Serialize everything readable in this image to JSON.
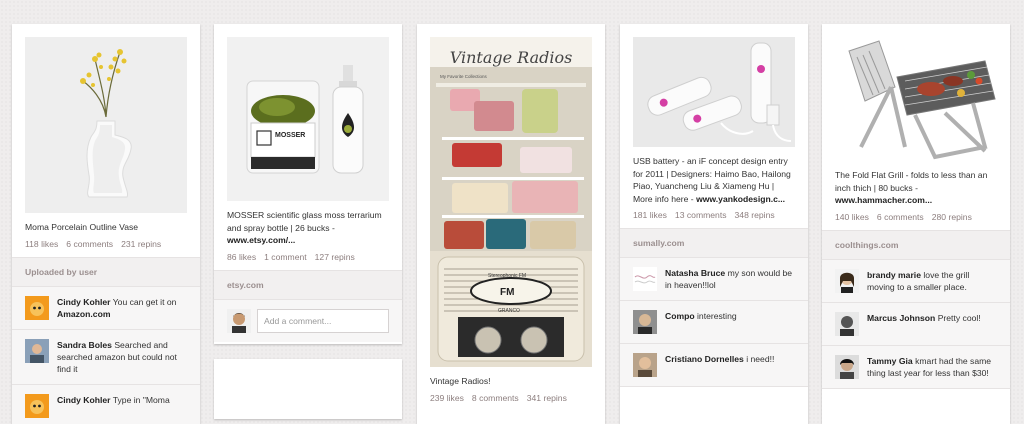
{
  "pins": [
    {
      "description": "Moma Porcelain Outline Vase",
      "likes": "118 likes",
      "comments": "6 comments",
      "repins": "231 repins",
      "via": "Uploaded by user",
      "comment_list": [
        {
          "user": "Cindy Kohler",
          "text": "You can get it on ",
          "bold": "Amazon.com"
        },
        {
          "user": "Sandra Boles",
          "text": "Searched and searched amazon but could not find it",
          "bold": ""
        },
        {
          "user": "Cindy Kohler",
          "text": "Type in \"Moma",
          "bold": ""
        }
      ]
    },
    {
      "description": "MOSSER scientific glass moss terrarium and spray bottle | 26 bucks - ",
      "source": "www.etsy.com/...",
      "likes": "86 likes",
      "comments": "1 comment",
      "repins": "127 repins",
      "via": "etsy.com",
      "add_comment_placeholder": "Add a comment...",
      "terrarium_label": "MOSSER"
    },
    {
      "image_title": "Vintage Radios",
      "collection_label": "My Favorite Collections",
      "radio_brand": "FM",
      "radio_maker": "GRANCO",
      "radio_band": "Stereophonic FM",
      "description": "Vintage Radios!",
      "likes": "239 likes",
      "comments": "8 comments",
      "repins": "341 repins"
    },
    {
      "description": "USB battery - an iF concept design entry for 2011 | Designers: Haimo Bao, Hailong Piao, Yuancheng Liu & Xiameng Hu | More info here - ",
      "source": "www.yankodesign.c...",
      "likes": "181 likes",
      "comments": "13 comments",
      "repins": "348 repins",
      "via": "sumally.com",
      "comment_list": [
        {
          "user": "Natasha Bruce",
          "text": "my son would be in heaven!!lol",
          "bold": ""
        },
        {
          "user": "Compo",
          "text": "interesting",
          "bold": ""
        },
        {
          "user": "Cristiano Dornelles",
          "text": "i need!!",
          "bold": ""
        }
      ]
    },
    {
      "description": "The Fold Flat Grill - folds to less than an inch thich | 80 bucks - ",
      "source": "www.hammacher.com...",
      "likes": "140 likes",
      "comments": "6 comments",
      "repins": "280 repins",
      "via": "coolthings.com",
      "comment_list": [
        {
          "user": "brandy marie",
          "text": "love the grill moving to a smaller place.",
          "bold": ""
        },
        {
          "user": "Marcus Johnson",
          "text": "Pretty cool!",
          "bold": ""
        },
        {
          "user": "Tammy Gia",
          "text": "kmart had the same thing last year for less than $30!",
          "bold": ""
        }
      ]
    }
  ]
}
